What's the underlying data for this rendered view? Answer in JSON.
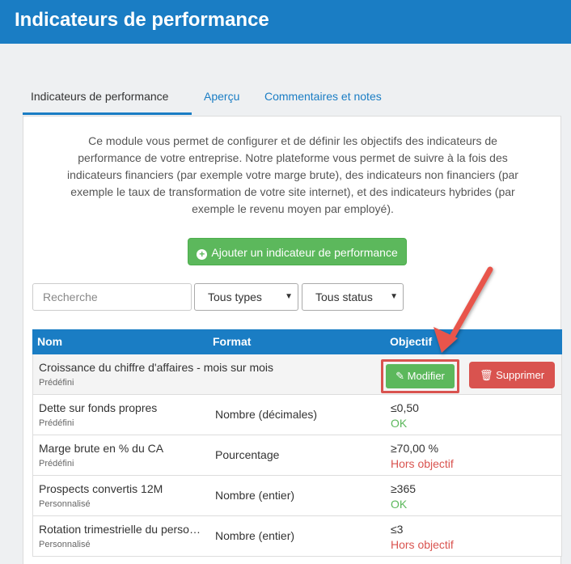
{
  "header": {
    "title": "Indicateurs de performance"
  },
  "tabs": [
    {
      "label": "Indicateurs de performance",
      "active": true
    },
    {
      "label": "Aperçu"
    },
    {
      "label": "Commentaires et notes"
    }
  ],
  "intro": "Ce module vous permet de configurer et de définir les objectifs des indicateurs de performance de votre entreprise. Notre plateforme vous permet de suivre à la fois des indicateurs financiers (par exemple votre marge brute), des indicateurs non financiers (par exemple le taux de transformation de votre site internet), et des indicateurs hybrides (par exemple le revenu moyen par employé).",
  "add_button": "Ajouter un indicateur de performance",
  "search": {
    "placeholder": "Recherche"
  },
  "filters": {
    "types": "Tous types",
    "status": "Tous status"
  },
  "table": {
    "columns": [
      "Nom",
      "Format",
      "Objectif"
    ],
    "rows": [
      {
        "name": "Croissance du chiffre d'affaires - mois sur mois",
        "sub": "Prédéfini",
        "format": "",
        "target": "",
        "status": ""
      },
      {
        "name": "Dette sur fonds propres",
        "sub": "Prédéfini",
        "format": "Nombre (décimales)",
        "target": "≤0,50",
        "status": "OK"
      },
      {
        "name": "Marge brute en % du CA",
        "sub": "Prédéfini",
        "format": "Pourcentage",
        "target": "≥70,00 %",
        "status": "Hors objectif"
      },
      {
        "name": "Prospects convertis 12M",
        "sub": "Personnalisé",
        "format": "Nombre (entier)",
        "target": "≥365",
        "status": "OK"
      },
      {
        "name": "Rotation trimestrielle du perso…",
        "sub": "Personnalisé",
        "format": "Nombre (entier)",
        "target": "≤3",
        "status": "Hors objectif"
      }
    ],
    "edit_label": "Modifier",
    "delete_label": "Supprimer"
  },
  "colors": {
    "primary": "#1a7dc4",
    "success": "#5cb85c",
    "danger": "#d9534f",
    "annotation": "#e8554b"
  },
  "icons": {
    "add": "plus-circle-icon",
    "edit": "pencil-icon",
    "delete": "trash-icon",
    "dropdown": "chevron-down-icon"
  }
}
